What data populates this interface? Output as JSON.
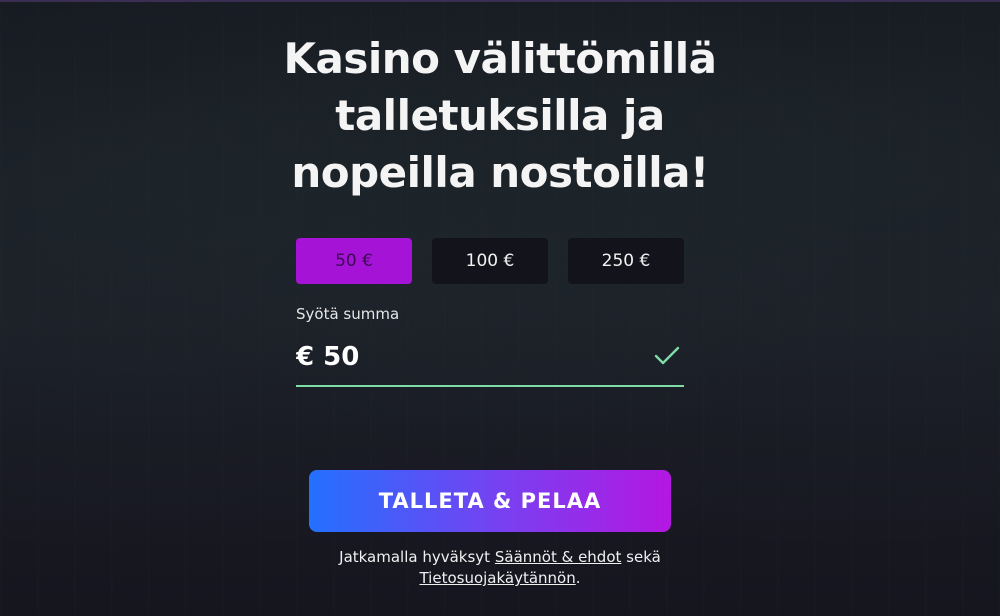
{
  "headline": {
    "line1": "Kasino välittömillä",
    "line2": "talletuksilla ja",
    "line3": "nopeilla nostoilla!"
  },
  "amount_options": [
    {
      "label": "50 €",
      "selected": true
    },
    {
      "label": "100 €",
      "selected": false
    },
    {
      "label": "250 €",
      "selected": false
    }
  ],
  "amount_input": {
    "label": "Syötä summa",
    "value": "€ 50",
    "valid_icon": "check-icon"
  },
  "cta": {
    "label": "TALLETA & PELAA"
  },
  "terms": {
    "prefix": "Jatkamalla hyväksyt",
    "link1": "Säännöt & ehdot",
    "middle": "sekä",
    "link2": "Tietosuojakäytännön",
    "suffix": "."
  },
  "colors": {
    "background": "#181823",
    "selected_option": "#a514d6",
    "valid_underline": "#7fdca7",
    "cta_gradient_start": "#2370ff",
    "cta_gradient_end": "#b417e2"
  }
}
